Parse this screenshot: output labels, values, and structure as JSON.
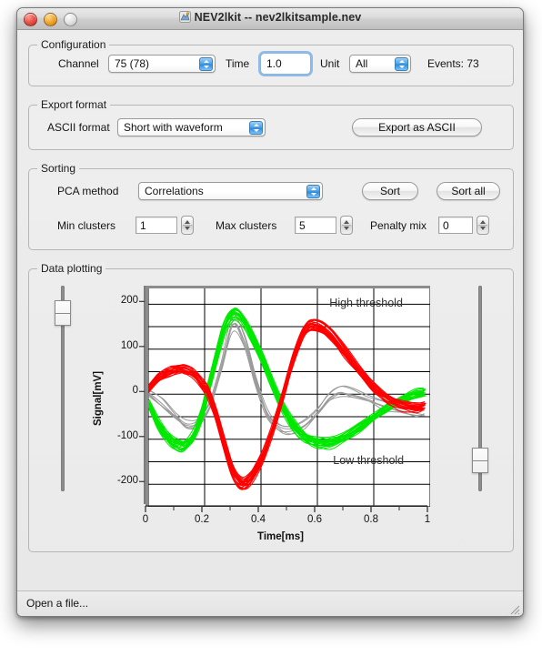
{
  "window": {
    "title": "NEV2lkit -- nev2lkitsample.nev",
    "app_icon": "nev2lkit-app-icon",
    "close_label": "",
    "minimize_label": "",
    "zoom_label": ""
  },
  "configuration": {
    "group_title": "Configuration",
    "channel_label": "Channel",
    "channel_value": "75 (78)",
    "time_label": "Time",
    "time_value": "1.0",
    "unit_label": "Unit",
    "unit_value": "All",
    "events_label": "Events: 73"
  },
  "export_format": {
    "group_title": "Export format",
    "ascii_label": "ASCII format",
    "ascii_value": "Short with waveform",
    "export_button": "Export as ASCII"
  },
  "sorting": {
    "group_title": "Sorting",
    "pca_label": "PCA method",
    "pca_value": "Correlations",
    "sort_button": "Sort",
    "sort_all_button": "Sort all",
    "min_clusters_label": "Min clusters",
    "min_clusters_value": "1",
    "max_clusters_label": "Max clusters",
    "max_clusters_value": "5",
    "penalty_mix_label": "Penalty mix",
    "penalty_mix_value": "0"
  },
  "data_plotting": {
    "group_title": "Data plotting",
    "high_threshold_label": "High threshold",
    "low_threshold_label": "Low threshold",
    "left_slider_name": "high-threshold-slider",
    "right_slider_name": "low-threshold-slider"
  },
  "status": {
    "message": "Open a file...",
    "grip": "resize-grip"
  },
  "colors": {
    "cluster_1": "#ff0000",
    "cluster_2": "#00e800",
    "unsorted": "#9a9a9a",
    "accent_blue": "#3f97e0",
    "window_bg": "#ededed"
  },
  "chart_data": {
    "type": "line",
    "title": "",
    "xlabel": "Time[ms]",
    "ylabel": "Signal[mV]",
    "xlim": [
      0,
      1
    ],
    "ylim": [
      -250,
      235
    ],
    "xticks": [
      0,
      0.2,
      0.4,
      0.6,
      0.8,
      1
    ],
    "xticklabels": [
      "0",
      "0.2",
      "0.4",
      "0.6",
      "0.8",
      "1"
    ],
    "yticks": [
      200,
      100,
      0,
      -100,
      -200
    ],
    "yticklabels": [
      "200",
      "100",
      "0",
      "-100",
      "-200"
    ],
    "grid": true,
    "grid_x_step": 0.2,
    "grid_y_step": 50,
    "minor_xticks": [
      0.1,
      0.3,
      0.5,
      0.7,
      0.9
    ],
    "annotations": [
      {
        "text": "High threshold",
        "x": 0.93,
        "y": 195,
        "align": "right"
      },
      {
        "text": "Low threshold",
        "x": 0.93,
        "y": -155,
        "align": "right"
      }
    ],
    "legend_position": "none",
    "series": [
      {
        "name": "cluster-1-red",
        "color": "#ff0000",
        "n_traces": 22,
        "jitter_y": 9,
        "jitter_x": 0.006,
        "x": [
          0,
          0.04,
          0.08,
          0.11,
          0.13,
          0.16,
          0.19,
          0.21,
          0.24,
          0.27,
          0.3,
          0.33,
          0.36,
          0.4,
          0.44,
          0.48,
          0.52,
          0.56,
          0.6,
          0.65,
          0.7,
          0.75,
          0.8,
          0.85,
          0.9,
          0.95,
          0.98
        ],
        "values": [
          12,
          36,
          50,
          55,
          53,
          44,
          24,
          5,
          -45,
          -110,
          -170,
          -198,
          -190,
          -150,
          -85,
          -5,
          85,
          143,
          150,
          128,
          90,
          50,
          15,
          -10,
          -25,
          -30,
          -28
        ]
      },
      {
        "name": "cluster-2-green",
        "color": "#00e800",
        "n_traces": 22,
        "jitter_y": 9,
        "jitter_x": 0.006,
        "x": [
          0,
          0.04,
          0.08,
          0.11,
          0.13,
          0.16,
          0.19,
          0.21,
          0.24,
          0.27,
          0.3,
          0.33,
          0.36,
          0.4,
          0.44,
          0.48,
          0.52,
          0.56,
          0.6,
          0.65,
          0.7,
          0.75,
          0.8,
          0.85,
          0.9,
          0.95,
          0.98
        ],
        "values": [
          -18,
          -68,
          -100,
          -112,
          -110,
          -92,
          -45,
          5,
          80,
          150,
          180,
          172,
          140,
          88,
          25,
          -30,
          -70,
          -95,
          -105,
          -105,
          -92,
          -72,
          -50,
          -28,
          -10,
          2,
          5
        ]
      },
      {
        "name": "unsorted-gray",
        "color": "#9a9a9a",
        "n_traces": 6,
        "jitter_y": 11,
        "jitter_x": 0.008,
        "x": [
          0,
          0.05,
          0.1,
          0.14,
          0.18,
          0.22,
          0.26,
          0.3,
          0.34,
          0.38,
          0.42,
          0.46,
          0.5,
          0.55,
          0.6,
          0.64,
          0.68,
          0.72,
          0.78,
          0.84,
          0.9,
          0.95,
          0.98
        ],
        "values": [
          3,
          -20,
          -50,
          -68,
          -60,
          -20,
          60,
          155,
          120,
          30,
          -40,
          -70,
          -80,
          -70,
          -40,
          -8,
          5,
          2,
          -10,
          -25,
          -35,
          -40,
          -42
        ]
      }
    ]
  }
}
